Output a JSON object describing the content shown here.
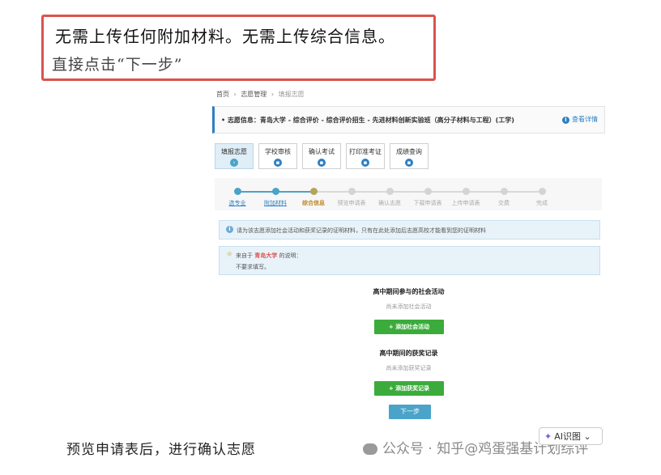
{
  "annotation": {
    "line1": "无需上传任何附加材料。无需上传综合信息。",
    "line2": "直接点击“下一步”"
  },
  "breadcrumb": [
    "首页",
    "志愿管理",
    "填报志愿"
  ],
  "info_bar": {
    "text": "志愿信息：青岛大学 - 综合评价 - 综合评价招生 - 先进材料创新实验班（高分子材料与工程）(工学)",
    "detail_label": "查看详情"
  },
  "tabs": [
    {
      "label": "填报志愿",
      "active": true
    },
    {
      "label": "学校审核",
      "active": false
    },
    {
      "label": "确认考试",
      "active": false
    },
    {
      "label": "打印准考证",
      "active": false
    },
    {
      "label": "成绩查询",
      "active": false
    }
  ],
  "steps": [
    {
      "label": "选专业",
      "state": "done"
    },
    {
      "label": "附加材料",
      "state": "done"
    },
    {
      "label": "综合信息",
      "state": "current"
    },
    {
      "label": "预览申请表",
      "state": "todo"
    },
    {
      "label": "确认志愿",
      "state": "todo"
    },
    {
      "label": "下载申请表",
      "state": "todo"
    },
    {
      "label": "上传申请表",
      "state": "todo"
    },
    {
      "label": "交费",
      "state": "todo"
    },
    {
      "label": "完成",
      "state": "todo"
    }
  ],
  "notice": "请为该志愿添加社会活动和获奖记录的证明材料，只有在此处添加后志愿高校才能看到您的证明材料",
  "school_note": {
    "prefix": "来自于",
    "school": "青岛大学",
    "suffix": "的说明：",
    "body": "不要求填写。"
  },
  "activities": {
    "title": "高中期间参与的社会活动",
    "empty": "尚未添加社会活动",
    "button": "+ 添加社会活动"
  },
  "awards": {
    "title": "高中期间的获奖记录",
    "empty": "尚未添加获奖记录",
    "button": "+ 添加获奖记录"
  },
  "next_button": "下一步",
  "caption": "预览申请表后，进行确认志愿",
  "watermark": "公众号 · 知乎@鸡蛋强基计划综评",
  "ai_chip": "AI识图"
}
